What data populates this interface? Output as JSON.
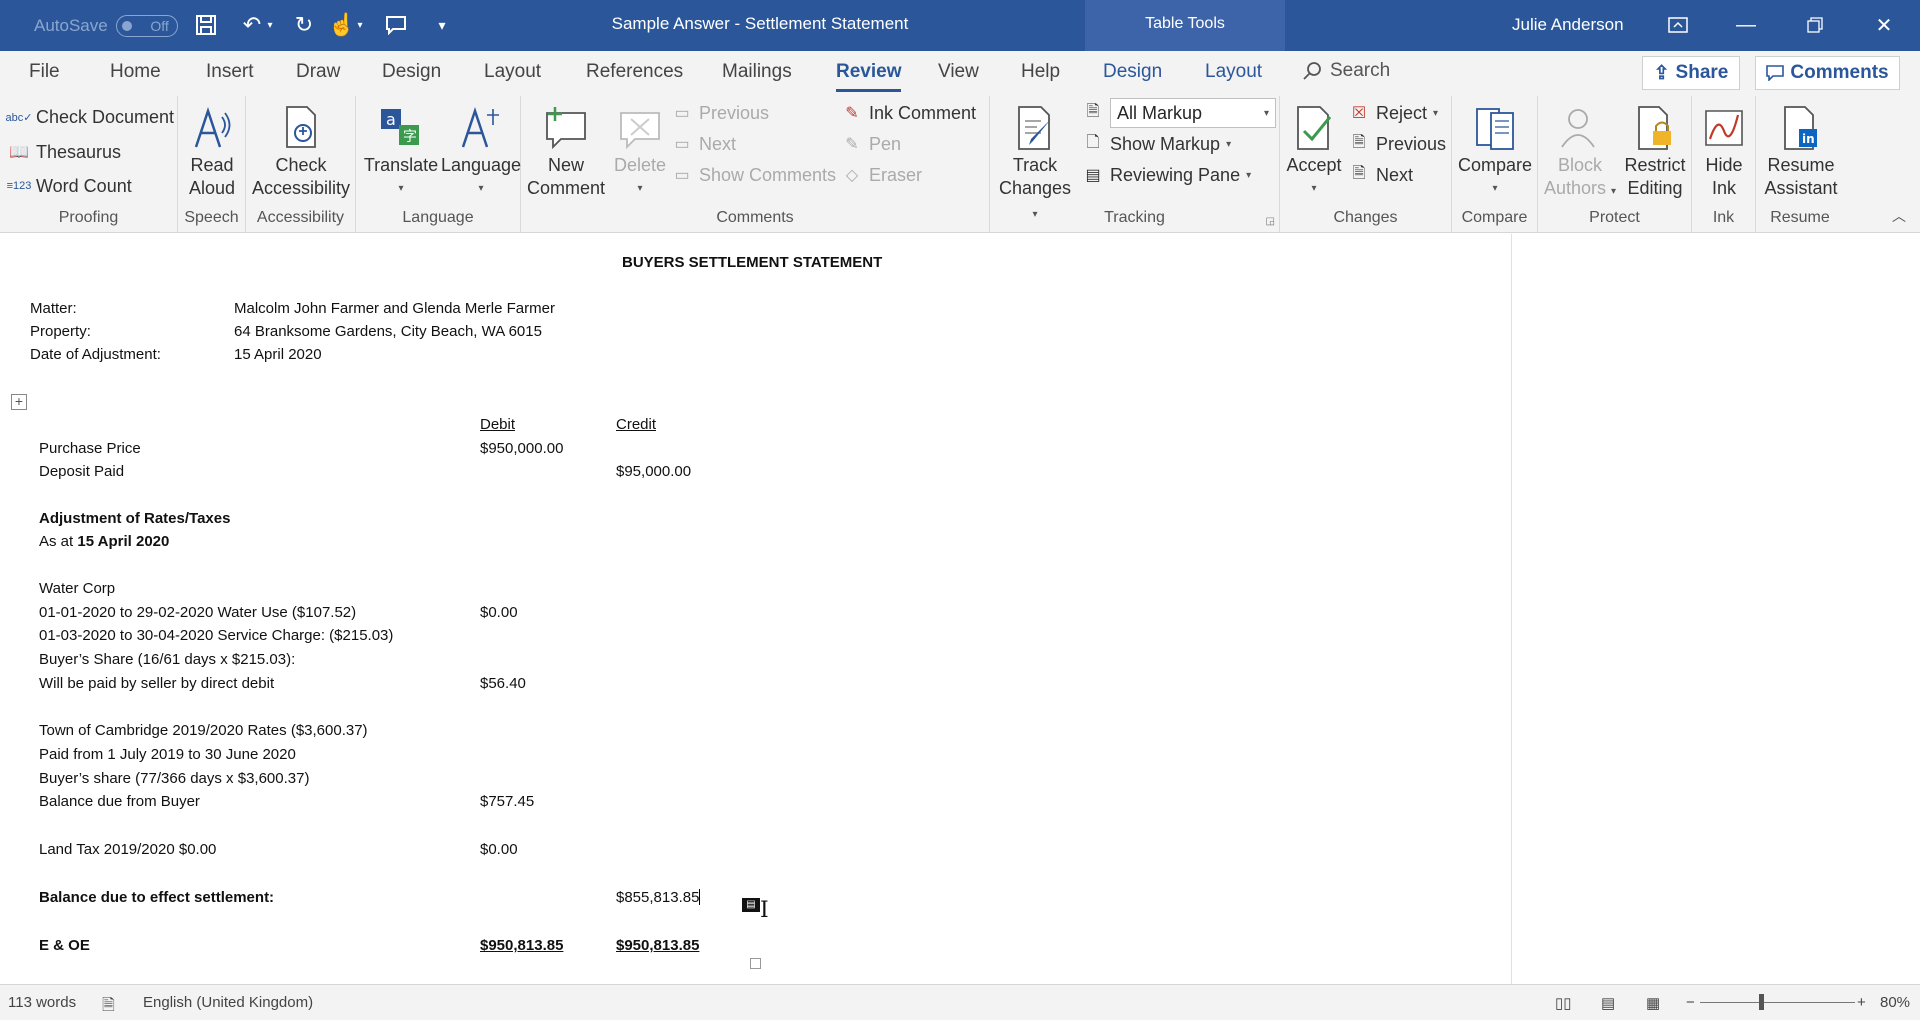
{
  "titlebar": {
    "autosave_label": "AutoSave",
    "autosave_state": "Off",
    "document_title": "Sample Answer - Settlement Statement",
    "context_tools": "Table Tools",
    "user_name": "Julie Anderson"
  },
  "tabs": [
    "File",
    "Home",
    "Insert",
    "Draw",
    "Design",
    "Layout",
    "References",
    "Mailings",
    "Review",
    "View",
    "Help",
    "Design",
    "Layout"
  ],
  "active_tab": "Review",
  "search_label": "Search",
  "share_label": "Share",
  "comments_label": "Comments",
  "ribbon": {
    "proofing": {
      "check_document": "Check Document",
      "thesaurus": "Thesaurus",
      "word_count": "Word Count",
      "label": "Proofing"
    },
    "speech": {
      "read_aloud_1": "Read",
      "read_aloud_2": "Aloud",
      "label": "Speech"
    },
    "accessibility": {
      "check_1": "Check",
      "check_2": "Accessibility",
      "label": "Accessibility"
    },
    "language": {
      "translate": "Translate",
      "language": "Language",
      "label": "Language"
    },
    "comments": {
      "new_1": "New",
      "new_2": "Comment",
      "delete": "Delete",
      "previous": "Previous",
      "next": "Next",
      "show_comments": "Show Comments",
      "label": "Comments"
    },
    "ink": {
      "ink_comment": "Ink Comment",
      "pen": "Pen",
      "eraser": "Eraser"
    },
    "tracking": {
      "track_1": "Track",
      "track_2": "Changes",
      "markup_value": "All Markup",
      "show_markup": "Show Markup",
      "reviewing_pane": "Reviewing Pane",
      "label": "Tracking"
    },
    "changes": {
      "accept": "Accept",
      "reject": "Reject",
      "previous": "Previous",
      "next": "Next",
      "label": "Changes"
    },
    "compare": {
      "compare": "Compare",
      "label": "Compare"
    },
    "protect": {
      "block_1": "Block",
      "block_2": "Authors",
      "restrict_1": "Restrict",
      "restrict_2": "Editing",
      "label": "Protect"
    },
    "inkgroup": {
      "hide_1": "Hide",
      "hide_2": "Ink",
      "label": "Ink"
    },
    "resume": {
      "resume_1": "Resume",
      "resume_2": "Assistant",
      "label": "Resume"
    }
  },
  "document": {
    "heading": "BUYERS SETTLEMENT STATEMENT",
    "matter_label": "Matter:",
    "matter_value": "Malcolm John Farmer and Glenda Merle Farmer",
    "property_label": "Property:",
    "property_value": "64 Branksome Gardens, City Beach, WA 6015",
    "date_label": "Date of Adjustment:",
    "date_value": "15 April 2020",
    "col_debit": "Debit",
    "col_credit": "Credit",
    "purchase_price": "Purchase Price",
    "purchase_price_debit": "$950,000.00",
    "deposit_paid": "Deposit Paid",
    "deposit_paid_credit": "$95,000.00",
    "adj_heading": "Adjustment of Rates/Taxes",
    "as_at": "As at ",
    "as_at_date": "15 April 2020",
    "water_corp": "Water Corp",
    "water_use": "01-01-2020 to 29-02-2020 Water Use ($107.52)",
    "water_use_debit": "$0.00",
    "service_charge": "01-03-2020 to 30-04-2020 Service Charge: ($215.03)",
    "buyer_share_water": "Buyer’s Share (16/61 days x $215.03):",
    "paid_by_seller": "Will be paid by seller by direct debit",
    "paid_by_seller_debit": "$56.40",
    "town_rates": "Town of Cambridge 2019/2020 Rates ($3,600.37)",
    "paid_from": "Paid from 1 July 2019 to 30 June 2020",
    "buyer_share_rates": "Buyer’s share (77/366 days x $3,600.37)",
    "balance_due_buyer": "Balance due from Buyer",
    "balance_due_buyer_debit": "$757.45",
    "land_tax": "Land Tax 2019/2020 $0.00",
    "land_tax_debit": "$0.00",
    "balance_settlement": "Balance due to effect settlement:",
    "balance_settlement_credit": "$855,813.85",
    "eoe": "E & OE",
    "total_debit": "$950,813.85",
    "total_credit": "$950,813.85"
  },
  "statusbar": {
    "word_count": "113 words",
    "language": "English (United Kingdom)",
    "zoom": "80%"
  }
}
